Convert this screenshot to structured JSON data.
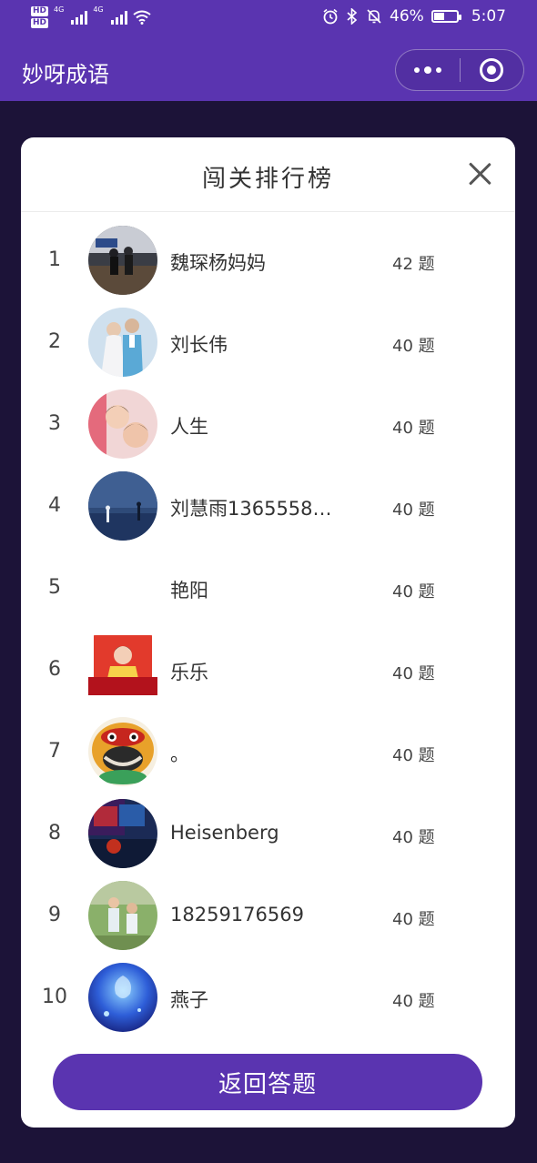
{
  "status": {
    "hd1": "HD",
    "hd2": "HD",
    "net1": "4G",
    "net2": "4G",
    "battery": "46%",
    "battery_level": 0.46,
    "time": "5:07"
  },
  "app": {
    "title": "妙呀成语"
  },
  "modal": {
    "title": "闯关排行榜",
    "return_label": "返回答题"
  },
  "leaderboard": [
    {
      "rank": "1",
      "name": "魏琛杨妈妈",
      "score": "42 题"
    },
    {
      "rank": "2",
      "name": "刘长伟",
      "score": "40 题"
    },
    {
      "rank": "3",
      "name": "人生",
      "score": "40 题"
    },
    {
      "rank": "4",
      "name": "刘慧雨1365558…",
      "score": "40 题"
    },
    {
      "rank": "5",
      "name": "艳阳",
      "score": "40 题"
    },
    {
      "rank": "6",
      "name": "乐乐",
      "score": "40 题"
    },
    {
      "rank": "7",
      "name": "。",
      "score": "40 题"
    },
    {
      "rank": "8",
      "name": "Heisenberg",
      "score": "40 题"
    },
    {
      "rank": "9",
      "name": "18259176569",
      "score": "40 题"
    },
    {
      "rank": "10",
      "name": "燕子",
      "score": "40 题"
    }
  ],
  "colors": {
    "brand": "#5a34b0",
    "backdrop": "#1c1338"
  }
}
